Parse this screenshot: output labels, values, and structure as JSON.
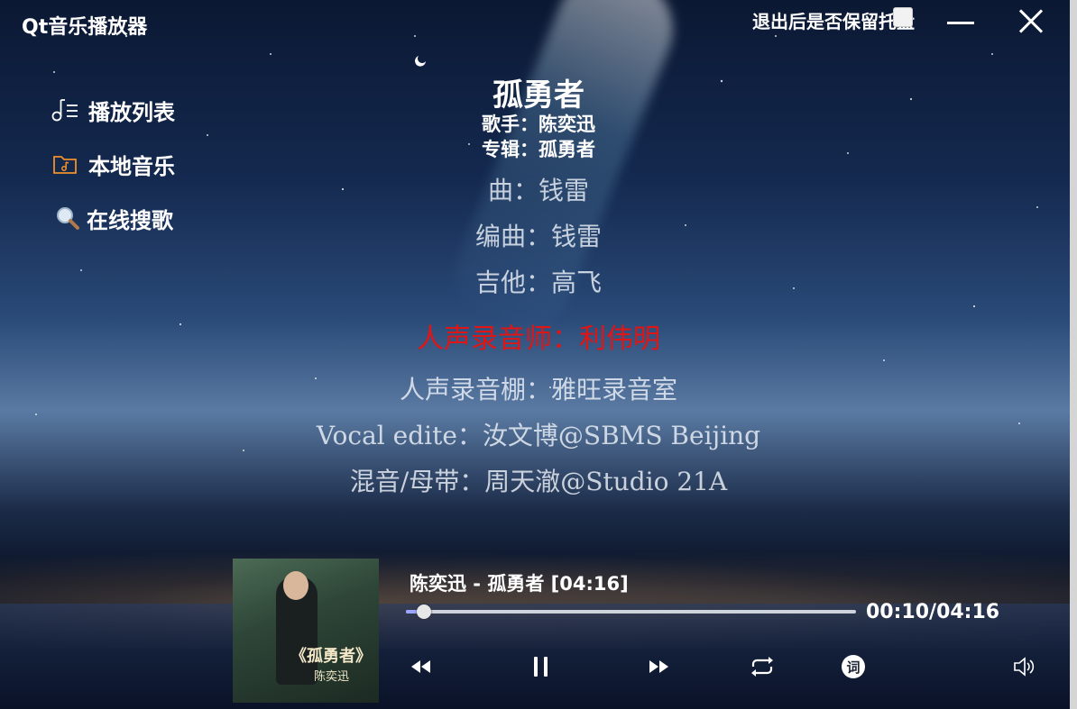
{
  "window": {
    "title": "Qt音乐播放器",
    "tray_label": "退出后是否保留托盘",
    "tray_checked": false
  },
  "sidebar": {
    "items": [
      {
        "label": "播放列表",
        "icon": "playlist-icon"
      },
      {
        "label": "本地音乐",
        "icon": "folder-music-icon"
      },
      {
        "label": "在线搜歌",
        "icon": "search-icon"
      }
    ]
  },
  "song": {
    "title": "孤勇者",
    "artist_line": "歌手：陈奕迅",
    "album_line": "专辑：孤勇者"
  },
  "lyrics": [
    {
      "text": "曲：钱雷",
      "active": false
    },
    {
      "text": "编曲：钱雷",
      "active": false
    },
    {
      "text": "吉他：高飞",
      "active": false
    },
    {
      "text": "人声录音师：利伟明",
      "active": true
    },
    {
      "text": "人声录音棚：雅旺录音室",
      "active": false
    },
    {
      "text": "Vocal edite：汝文博@SBMS Beijing",
      "active": false
    },
    {
      "text": "混音/母带：周天澈@Studio 21A",
      "active": false
    }
  ],
  "player": {
    "track_info": "陈奕迅 - 孤勇者 [04:16]",
    "time_display": "00:10/04:16",
    "progress": 0.04,
    "cover_title": "《孤勇者》",
    "cover_artist": "陈奕迅",
    "controls": {
      "lyrics_glyph": "词"
    }
  },
  "colors": {
    "active_lyric": "#e01515",
    "text": "#ffffff"
  }
}
